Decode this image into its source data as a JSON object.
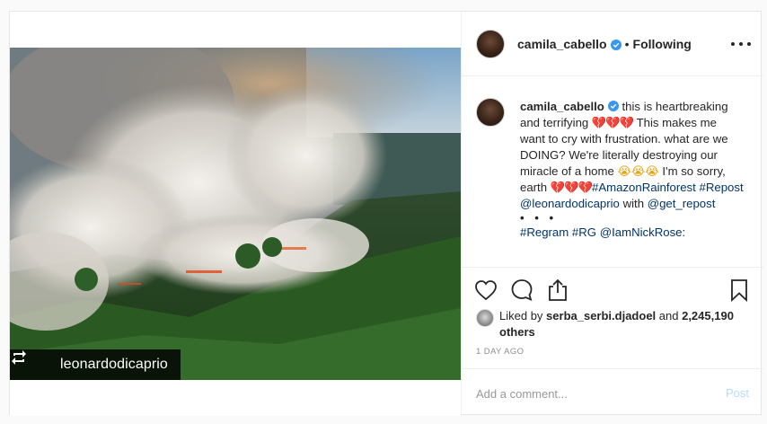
{
  "post": {
    "author": "camila_cabello",
    "follow_status": "Following",
    "separator": "•",
    "caption": {
      "username": "camila_cabello",
      "segments": [
        {
          "text": " this is heartbreaking and terrifying ",
          "type": "text"
        },
        {
          "text": "💔💔💔",
          "type": "heart"
        },
        {
          "text": " This makes me want to cry with frustration. what are we DOING? We're literally destroying our miracle of a home ",
          "type": "text"
        },
        {
          "text": "😭😭😭",
          "type": "cry"
        },
        {
          "text": " I'm so sorry, earth ",
          "type": "text"
        },
        {
          "text": "💔💔💔",
          "type": "heart"
        },
        {
          "text": "#AmazonRainforest",
          "type": "tag"
        },
        {
          "text": " ",
          "type": "text"
        },
        {
          "text": "#Repost",
          "type": "tag"
        },
        {
          "text": " ",
          "type": "text"
        },
        {
          "text": "@leonardodicaprio",
          "type": "tag"
        },
        {
          "text": " with ",
          "type": "text"
        },
        {
          "text": "@get_repost",
          "type": "tag"
        }
      ],
      "dots": "• • •",
      "second_line": [
        {
          "text": "#Regram",
          "type": "tag"
        },
        {
          "text": " ",
          "type": "text"
        },
        {
          "text": "#RG",
          "type": "tag"
        },
        {
          "text": " ",
          "type": "text"
        },
        {
          "text": "@IamNickRose",
          "type": "tag"
        },
        {
          "text": ":",
          "type": "text"
        }
      ]
    },
    "repost_handle": "leonardodicaprio",
    "likes": {
      "prefix": "Liked by ",
      "user": "serba_serbi.djadoel",
      "middle": " and ",
      "count": "2,245,190 others"
    },
    "timestamp": "1 DAY AGO",
    "comment": {
      "placeholder": "Add a comment...",
      "value": "",
      "post_label": "Post"
    }
  },
  "icons": {
    "verified": "verified-badge-icon",
    "more": "more-options-icon",
    "like": "heart-outline-icon",
    "comment": "comment-bubble-icon",
    "share": "share-icon",
    "save": "bookmark-icon",
    "repost": "repost-icon"
  },
  "colors": {
    "verified_blue": "#3897f0",
    "tag_blue": "#003569",
    "post_button_disabled": "#b2dffc",
    "timestamp_gray": "#8e8e8e"
  }
}
